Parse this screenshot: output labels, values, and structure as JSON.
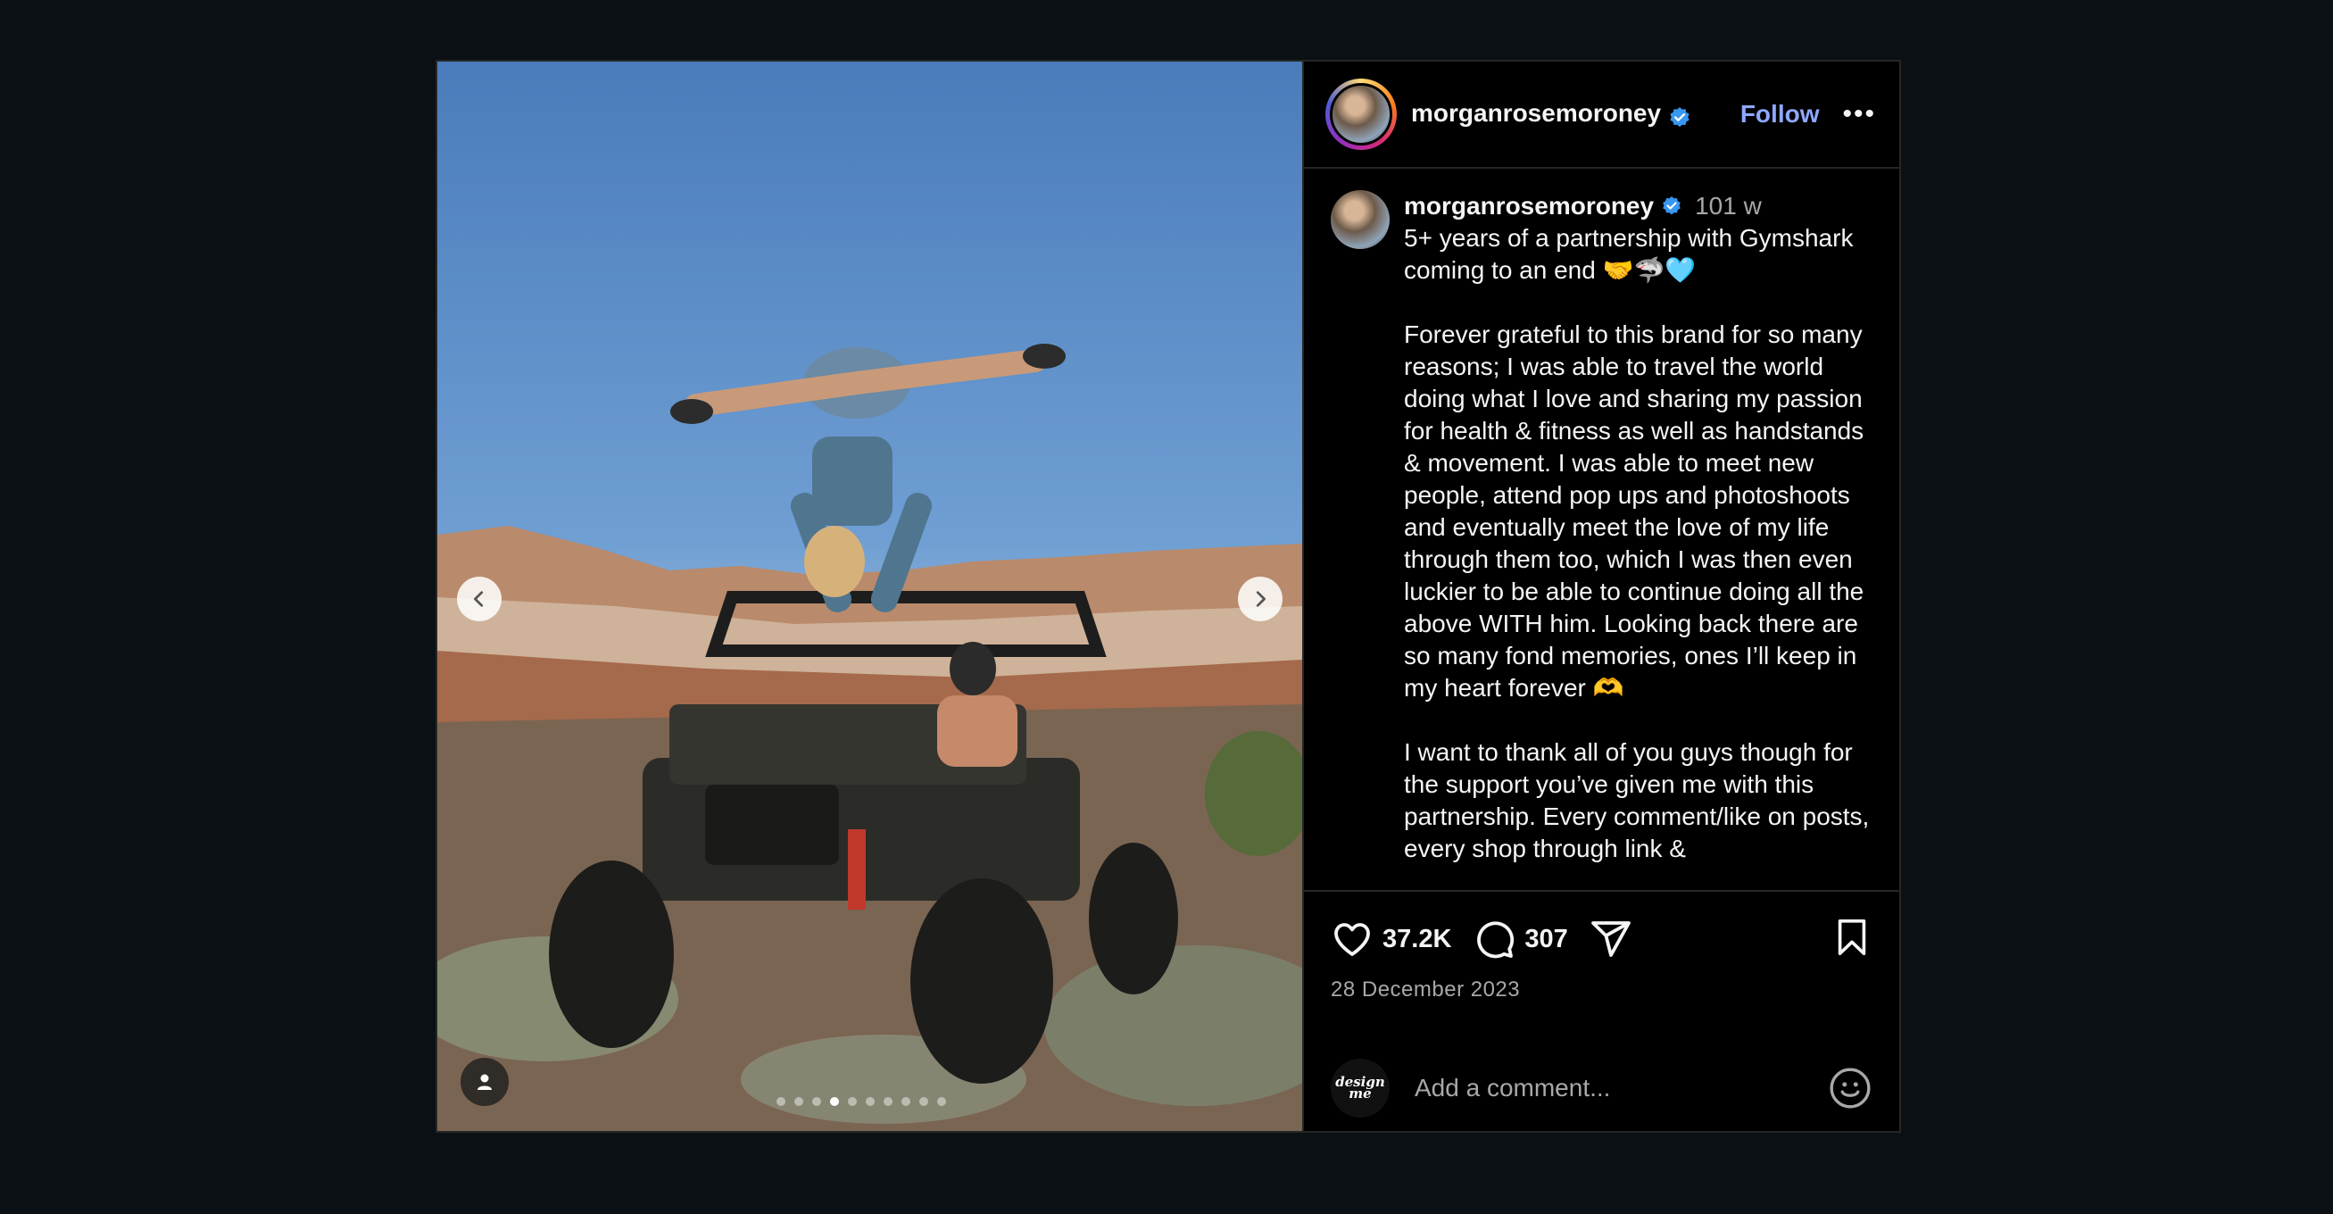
{
  "post": {
    "username": "morganrosemoroney",
    "follow_label": "Follow",
    "more_label": "•••",
    "time_ago": "101 w",
    "caption": "5+ years of a partnership with Gymshark coming to an end 🤝🦈🩵\n\nForever grateful to this brand for so many reasons; I was able to travel the world doing what I love and sharing my passion for health & fitness as well as handstands & movement. I was able to meet new people, attend pop ups and photoshoots and eventually meet the love of my life through them too, which I was then even luckier to be able to continue doing all the above WITH him. Looking back there are so many fond memories, ones I’ll keep in my heart forever 🫶\n\nI want to thank all of you guys though for the support you’ve given me with this partnership. Every comment/like on posts, every shop through link &",
    "likes": "37.2K",
    "comments": "307",
    "date": "28 December 2023",
    "comment_placeholder": "Add a comment...",
    "my_avatar_text": "design\nme",
    "carousel": {
      "total": 10,
      "active_index": 3
    }
  },
  "colors": {
    "background": "#0b1014",
    "accent": "#8fa7ff",
    "verified": "#3897f0",
    "muted": "#a8a8a8"
  },
  "icons": [
    "chevron-left-icon",
    "chevron-right-icon",
    "user-tag-icon",
    "verified-icon",
    "heart-icon",
    "comment-icon",
    "share-icon",
    "bookmark-icon",
    "emoji-icon"
  ]
}
